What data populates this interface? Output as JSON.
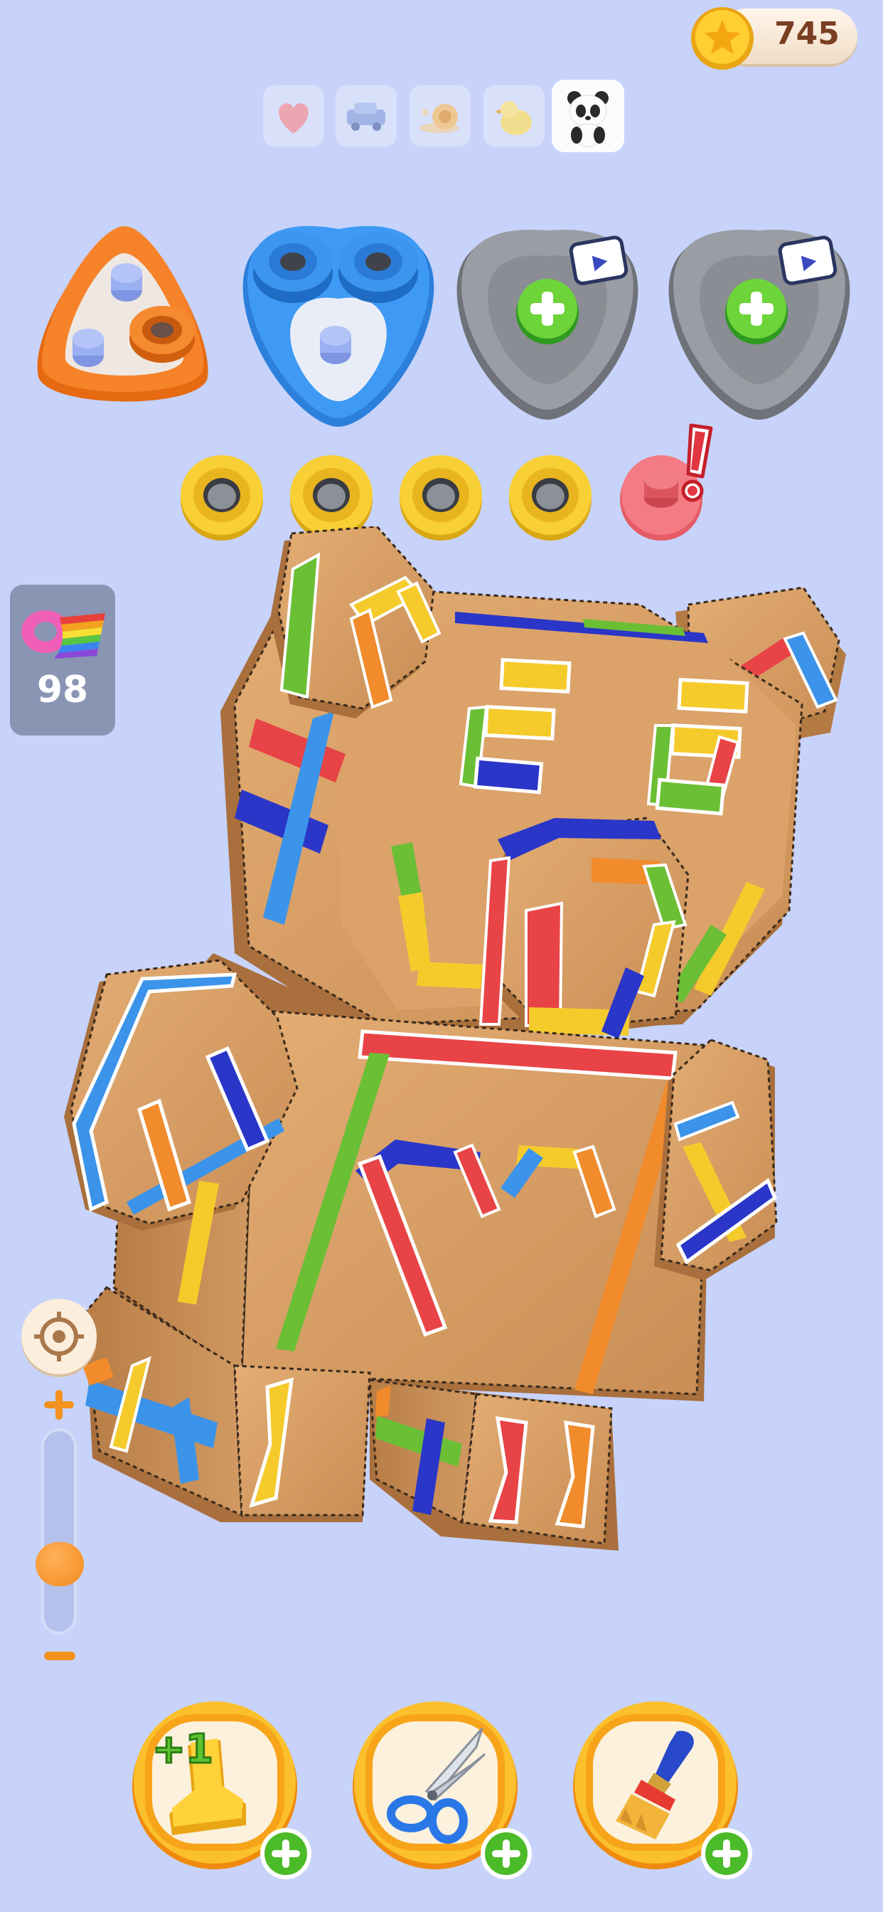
{
  "coins": {
    "value": "745",
    "icon": "gold-star-coin"
  },
  "level_tabs": [
    {
      "icon": "heart",
      "active": false
    },
    {
      "icon": "car",
      "active": false
    },
    {
      "icon": "snail",
      "active": false
    },
    {
      "icon": "chick",
      "active": false
    },
    {
      "icon": "panda",
      "active": true
    }
  ],
  "holders": [
    {
      "color": "#f47b1c",
      "state": "partial"
    },
    {
      "color": "#3a95f0",
      "state": "partial"
    },
    {
      "color": "#8a8d93",
      "state": "locked-video"
    },
    {
      "color": "#8a8d93",
      "state": "locked-video"
    }
  ],
  "ring_slots": [
    {
      "color": "#f6c62c"
    },
    {
      "color": "#f6c62c"
    },
    {
      "color": "#f6c62c"
    },
    {
      "color": "#f6c62c"
    },
    {
      "color": "#f0757c",
      "state": "warning"
    }
  ],
  "tape": {
    "count": "98",
    "icon": "rainbow-tape-roll"
  },
  "zoom": {
    "level": 0.3,
    "plus_icon": "plus",
    "minus_icon": "minus",
    "center_icon": "target"
  },
  "boosters": [
    {
      "name": "plus-one-stamp",
      "badge": "+1"
    },
    {
      "name": "scissors",
      "badge": ""
    },
    {
      "name": "brush",
      "badge": ""
    }
  ],
  "colors": {
    "background": "#c7d3fa",
    "cardboard": "#d7a06a",
    "cardboard_dark": "#b57a45",
    "red": "#e84346",
    "blue": "#2a36c8",
    "light_blue": "#3b94ea",
    "yellow": "#f5cb2c",
    "green": "#6bbf35",
    "orange": "#f18b2c"
  }
}
